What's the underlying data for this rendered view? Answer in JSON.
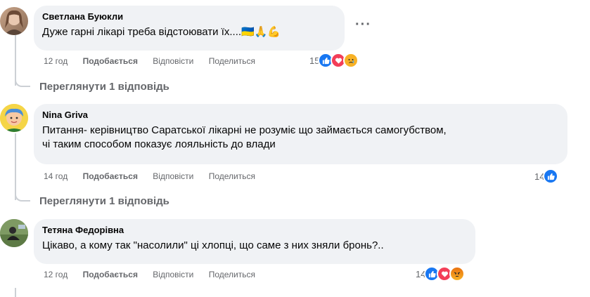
{
  "comments": [
    {
      "author": "Светлана Буюкли",
      "text": "Дуже гарні лікарі треба відстоювати їх....",
      "emoji": "🇺🇦🙏💪",
      "time": "12 год",
      "like_label": "Подобається",
      "reply_label": "Відповісти",
      "share_label": "Поделиться",
      "reaction_count": "15",
      "reactions": [
        "like",
        "love",
        "sad"
      ],
      "view_replies": "Переглянути 1 відповідь"
    },
    {
      "author": "Nina Griva",
      "text_line1": "Питання- керівництво Саратської лікарні не розуміє що займається самогубством,",
      "text_line2": "чі таким способом показує лояльність до влади",
      "time": "14 год",
      "like_label": "Подобається",
      "reply_label": "Відповісти",
      "share_label": "Поделиться",
      "reaction_count": "14",
      "reactions": [
        "like"
      ],
      "view_replies": "Переглянути 1 відповідь"
    },
    {
      "author": "Тетяна Федорівна",
      "text": "Цікаво, а кому так \"насолили\" ці хлопці, що саме з них зняли бронь?..",
      "time": "12 год",
      "like_label": "Подобається",
      "reply_label": "Відповісти",
      "share_label": "Поделиться",
      "reaction_count": "14",
      "reactions": [
        "like",
        "love",
        "angry"
      ]
    }
  ],
  "colors": {
    "bubble": "#f0f2f5",
    "meta_text": "#65676b",
    "like": "#1877f2",
    "love": "#f33e58",
    "sad": "#f7b125"
  }
}
